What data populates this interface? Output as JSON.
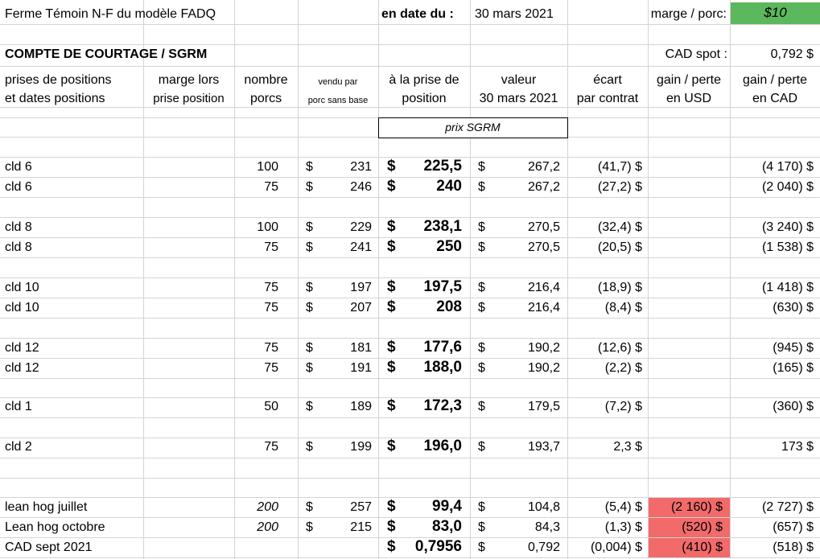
{
  "colors": {
    "gridline": "#d4d4d4",
    "green_fill": "#5cb85c",
    "red_fill": "#f26a6a"
  },
  "header": {
    "title": "Ferme Témoin  N-F du modèle FADQ",
    "date_label": "en date du :",
    "date_value": "30 mars 2021",
    "marge_label": "marge / porc:",
    "marge_value": "$10",
    "section_title": "COMPTE DE COURTAGE / SGRM",
    "cad_spot_label": "CAD spot :",
    "cad_spot_value": "0,792 $"
  },
  "columns": {
    "c1a": "prises de positions",
    "c1b": "et dates positions",
    "c2a": "marge lors",
    "c2b": "prise position",
    "c3a": "nombre",
    "c3b": "porcs",
    "c4a": "vendu par",
    "c4b": "porc sans base",
    "c5a": "à la prise de",
    "c5b": "position",
    "c6a": "valeur",
    "c6b": "30 mars 2021",
    "c7a": "écart",
    "c7b": "par contrat",
    "c8a": "gain / perte",
    "c8b": "en USD",
    "c9a": "gain / perte",
    "c9b": "en CAD"
  },
  "prix_label": "prix SGRM",
  "currency_symbol": "$",
  "rows": [
    {
      "name": "cld 6",
      "nombre": "100",
      "vendu": "231",
      "prise": "225,5",
      "valeur": "267,2",
      "ecart": "(41,7) $",
      "usd": "",
      "cad": "(4 170) $"
    },
    {
      "name": "cld 6",
      "nombre": "75",
      "vendu": "246",
      "prise": "240",
      "valeur": "267,2",
      "ecart": "(27,2) $",
      "usd": "",
      "cad": "(2 040) $"
    },
    {
      "name": "cld 8",
      "nombre": "100",
      "vendu": "229",
      "prise": "238,1",
      "valeur": "270,5",
      "ecart": "(32,4) $",
      "usd": "",
      "cad": "(3 240) $"
    },
    {
      "name": "cld 8",
      "nombre": "75",
      "vendu": "241",
      "prise": "250",
      "valeur": "270,5",
      "ecart": "(20,5) $",
      "usd": "",
      "cad": "(1 538) $"
    },
    {
      "name": "cld 10",
      "nombre": "75",
      "vendu": "197",
      "prise": "197,5",
      "valeur": "216,4",
      "ecart": "(18,9) $",
      "usd": "",
      "cad": "(1 418) $"
    },
    {
      "name": "cld 10",
      "nombre": "75",
      "vendu": "207",
      "prise": "208",
      "valeur": "216,4",
      "ecart": "(8,4) $",
      "usd": "",
      "cad": "(630) $"
    },
    {
      "name": "cld 12",
      "nombre": "75",
      "vendu": "181",
      "prise": "177,6",
      "valeur": "190,2",
      "ecart": "(12,6) $",
      "usd": "",
      "cad": "(945) $"
    },
    {
      "name": "cld 12",
      "nombre": "75",
      "vendu": "191",
      "prise": "188,0",
      "valeur": "190,2",
      "ecart": "(2,2) $",
      "usd": "",
      "cad": "(165) $"
    },
    {
      "name": "cld 1",
      "nombre": "50",
      "vendu": "189",
      "prise": "172,3",
      "valeur": "179,5",
      "ecart": "(7,2) $",
      "usd": "",
      "cad": "(360) $"
    },
    {
      "name": "cld 2",
      "nombre": "75",
      "vendu": "199",
      "prise": "196,0",
      "valeur": "193,7",
      "ecart": "2,3  $",
      "usd": "",
      "cad": "173  $"
    },
    {
      "name": "lean hog  juillet",
      "nombre": "200",
      "vendu": "257",
      "prise": "99,4",
      "valeur": "104,8",
      "ecart": "(5,4) $",
      "usd": "(2 160) $",
      "cad": "(2 727) $"
    },
    {
      "name": "Lean hog octobre",
      "nombre": "200",
      "vendu": "215",
      "prise": "83,0",
      "valeur": "84,3",
      "ecart": "(1,3) $",
      "usd": "(520) $",
      "cad": "(657) $"
    },
    {
      "name": "CAD  sept 2021",
      "nombre": "",
      "vendu": "",
      "prise": "0,7956",
      "valeur": "0,792",
      "ecart": "(0,004) $",
      "usd": "(410) $",
      "cad": "(518) $"
    }
  ]
}
